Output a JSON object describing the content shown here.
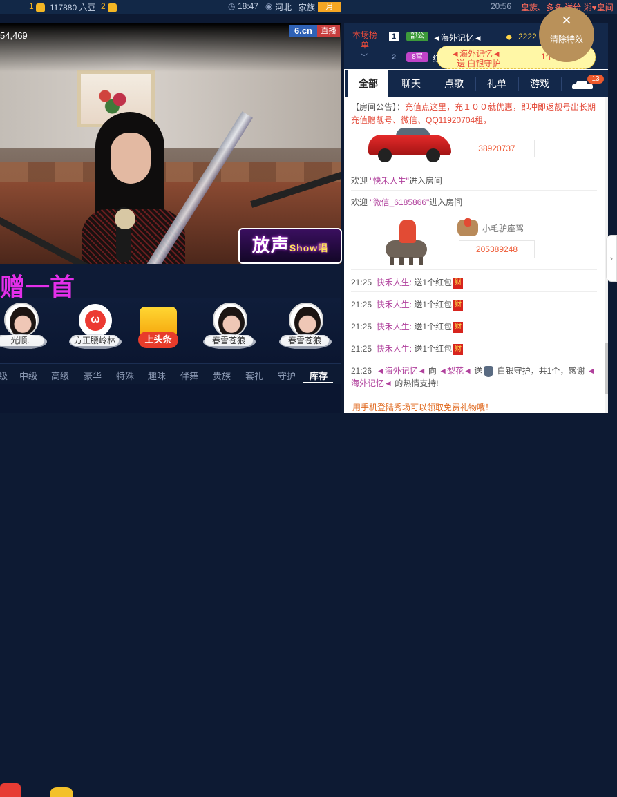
{
  "topbar": {
    "level1": "1",
    "beans": "117880 六豆",
    "level2": "2",
    "time": "18:47",
    "location": "河北",
    "family_label": "家族",
    "month_badge": "月",
    "right_time": "20:56",
    "marquee": "皇族、多多 送给 湘♥皇间"
  },
  "video": {
    "viewer_count": "54,469",
    "brand": "6.cn",
    "live_badge": "直播",
    "show_logo_main": "放声",
    "show_logo_sub": "Show唱"
  },
  "song_banner": "赠一首",
  "stage": {
    "idols": [
      {
        "name": "光顺."
      },
      {
        "name": "方正腰岭林"
      },
      {
        "name": "春雪苍狼"
      },
      {
        "name": "春雪苍狼"
      }
    ],
    "toutiao": "上头条",
    "redface": "ω"
  },
  "gift_tabs": [
    "级",
    "中级",
    "高级",
    "豪华",
    "特殊",
    "趣味",
    "伴舞",
    "贵族",
    "套礼",
    "守护",
    "库存"
  ],
  "rank": {
    "title": "本场榜单",
    "arrow": "﹀",
    "rows": [
      {
        "num": "1",
        "badge": "部公",
        "name": "◄海外记忆◄",
        "value": "2222"
      },
      {
        "num": "2",
        "badge": "8富",
        "name": "红",
        "value": ""
      }
    ]
  },
  "gift_bubble": {
    "line1": "◄海外记忆◄",
    "line2": "送 白银守护",
    "count": "1个"
  },
  "clear_effects": {
    "icon": "×",
    "label": "清除特效"
  },
  "chat_tabs": [
    {
      "label": "全部"
    },
    {
      "label": "聊天"
    },
    {
      "label": "点歌"
    },
    {
      "label": "礼单"
    },
    {
      "label": "游戏"
    }
  ],
  "car_badge": "13",
  "chat": {
    "notice_label": "【房间公告】：",
    "notice_text": "充值点这里，充１００就优惠，即冲即返靓号出长期充值赠靓号、微信、QQ11920704租，",
    "car1_value": "38920737",
    "welcome1_prefix": "欢迎",
    "welcome1_name": "\"快禾人生\"",
    "welcome1_suffix": "进入房间",
    "welcome2_prefix": "欢迎",
    "welcome2_name": "\"微信_6185866\"",
    "welcome2_suffix": "进入房间",
    "car2_label": "小毛驴座驾",
    "car2_value": "205389248",
    "gift_lines": [
      {
        "time": "21:25",
        "nick": "快禾人生:",
        "text": "送1个红包",
        "hb": "财"
      },
      {
        "time": "21:25",
        "nick": "快禾人生:",
        "text": "送1个红包",
        "hb": "财"
      },
      {
        "time": "21:25",
        "nick": "快禾人生:",
        "text": "送1个红包",
        "hb": "财"
      },
      {
        "time": "21:25",
        "nick": "快禾人生:",
        "text": "送1个红包",
        "hb": "财"
      }
    ],
    "guard_time": "21:26",
    "guard_from": "◄海外记忆◄",
    "guard_to_word": "向",
    "guard_to": "◄梨花◄",
    "guard_send": "送",
    "guard_text": "白银守护，共1个，感谢",
    "guard_from2": "◄",
    "guard_line2_name": "海外记忆◄",
    "guard_line2_text": "的热情支持!"
  },
  "bottom_notice": "用手机登陆秀场可以领取免费礼物哦！",
  "edge_handle": "›"
}
